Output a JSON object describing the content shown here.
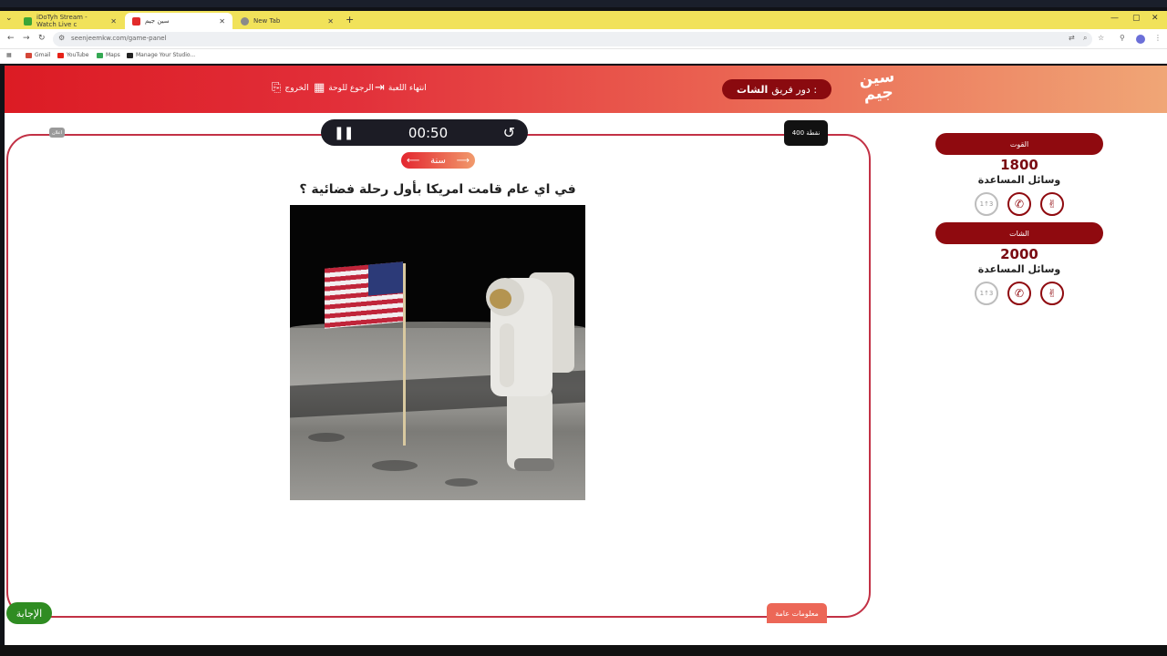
{
  "browser": {
    "tabs": [
      {
        "label": "iDoTyh Stream - Watch Live c",
        "active": false
      },
      {
        "label": "سين جيم",
        "active": true
      },
      {
        "label": "New Tab",
        "active": false
      }
    ],
    "url": "seenjeemkw.com/game-panel",
    "bookmarks": [
      "Gmail",
      "YouTube",
      "Maps",
      "Manage Your Studio..."
    ]
  },
  "header": {
    "end_game": "انتهاء اللعبة",
    "back_to_board": "الرجوع للوحة",
    "exit": "الخروج",
    "turn_label": "دور فريق :",
    "turn_team": "الشات",
    "logo_line1": "سين",
    "logo_line2": "جيم"
  },
  "board": {
    "timer": "00:50",
    "points": "400 نقطة",
    "mini_label": "اعلان",
    "category": "سنة",
    "question": "في اي عام قامت امريكا بأول رحلة فضائية ؟",
    "info_button": "معلومات عامة",
    "answer_button": "الإجابة"
  },
  "teams": [
    {
      "name": "القوت",
      "score": "1800",
      "aids_label": "وسائل المساعدة"
    },
    {
      "name": "الشات",
      "score": "2000",
      "aids_label": "وسائل المساعدة"
    }
  ],
  "colors": {
    "accent_dark": "#8f0a0f",
    "header_start": "#dc1b24",
    "header_end": "#f0a676",
    "answer_green": "#2f8c22"
  }
}
